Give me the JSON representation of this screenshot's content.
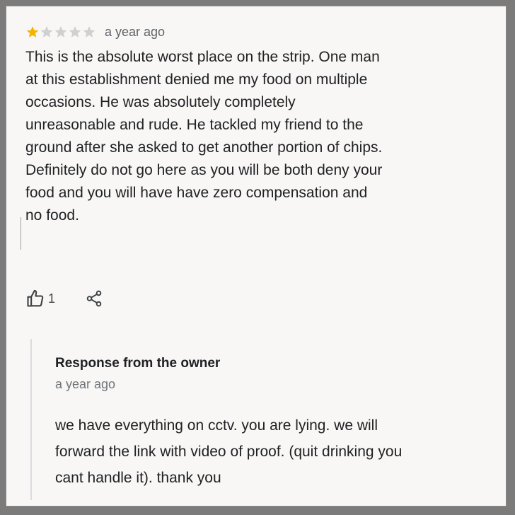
{
  "review": {
    "rating": 1,
    "max_rating": 5,
    "star_filled_color": "#f4b400",
    "star_empty_color": "#d0d0d0",
    "time": "a year ago",
    "text": "This is the  absolute worst place on the strip. One man\nat this establishment denied me my food on multiple\noccasions. He was absolutely completely\nunreasonable and rude. He tackled my friend to the\nground after she asked to get another portion of chips.\nDefinitely do not go here as you will be both deny your\nfood and you will have have zero compensation and\nno food."
  },
  "actions": {
    "like_icon": "thumbs-up-icon",
    "like_count": "1",
    "share_icon": "share-icon"
  },
  "owner_response": {
    "title": "Response from the owner",
    "time": "a year ago",
    "text": "we have everything on cctv. you are lying. we will\nforward the link with video of proof. (quit drinking you\ncant handle it). thank you"
  }
}
